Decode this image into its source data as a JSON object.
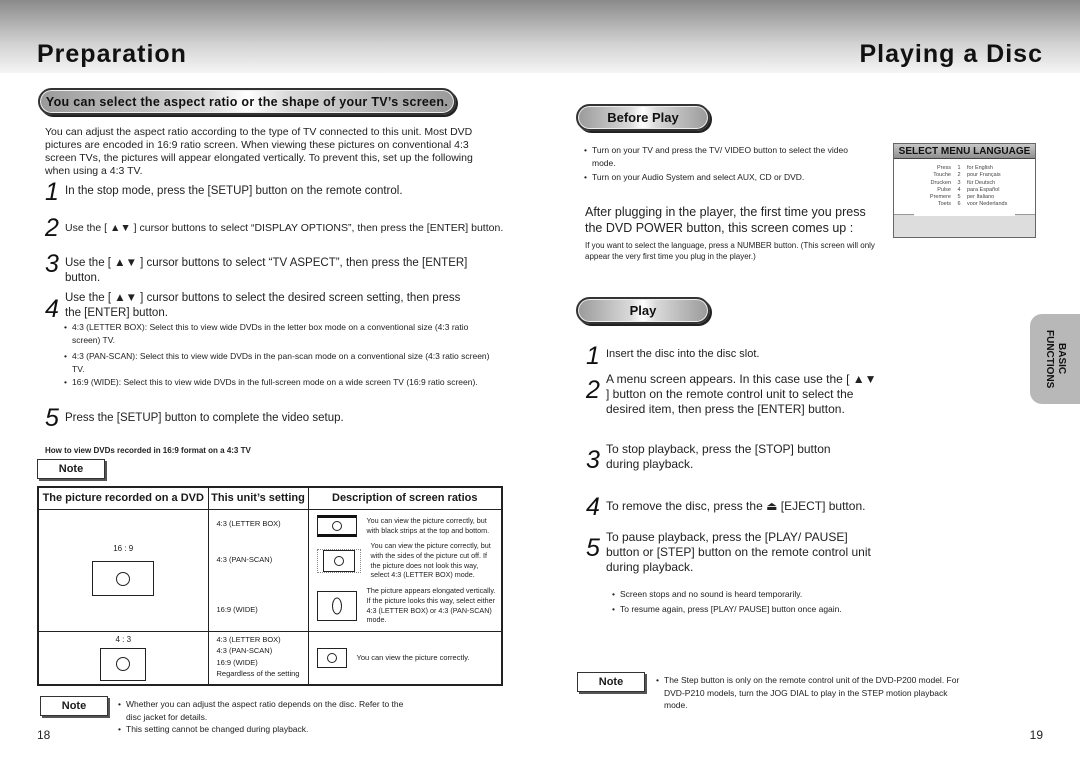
{
  "header": {
    "left_title": "Preparation",
    "right_title": "Playing a Disc"
  },
  "left": {
    "banner": "You can select the aspect ratio or the shape of your TV’s screen.",
    "intro": "You can adjust the aspect ratio according to the type of TV connected to this unit. Most DVD pictures are encoded in 16:9 ratio screen. When viewing these pictures on conventional 4:3 screen TVs, the pictures will appear elongated vertically. To prevent this, set up the following when using a 4:3 TV.",
    "steps": [
      {
        "num": "1",
        "text": "In the stop mode, press the [SETUP] button on the remote control."
      },
      {
        "num": "2",
        "text": "Use the [ ▲▼ ] cursor buttons to select “DISPLAY OPTIONS”, then press the [ENTER] button."
      },
      {
        "num": "3",
        "text": "Use the [ ▲▼ ] cursor buttons to select “TV ASPECT”, then press the [ENTER] button."
      },
      {
        "num": "4",
        "text": "Use the [ ▲▼ ] cursor buttons to select the desired screen setting, then press the [ENTER] button."
      },
      {
        "num": "5",
        "text": "Press the [SETUP] button to complete the video setup."
      }
    ],
    "step4_bullets": [
      "4:3 (LETTER BOX): Select this to view wide DVDs in the letter box mode on a conventional size (4:3 ratio screen) TV.",
      "4:3 (PAN-SCAN): Select this to view wide DVDs in the pan-scan mode on a conventional size (4:3 ratio screen) TV.",
      "16:9 (WIDE): Select this to view wide DVDs in the full-screen mode on a wide screen TV (16:9 ratio screen)."
    ],
    "howto_heading": "How to view DVDs recorded in 16:9 format on a 4:3 TV",
    "note_label": "Note",
    "table": {
      "headers": [
        "The picture recorded on a DVD",
        "This unit’s setting",
        "Description of screen ratios"
      ],
      "rows": [
        {
          "recorded": "16 : 9",
          "settings": [
            {
              "setting": "4:3 (LETTER BOX)",
              "description": "You can view the picture correctly, but with black strips at the top and bottom."
            },
            {
              "setting": "4:3 (PAN-SCAN)",
              "description": "You can view the picture correctly, but with the sides of the picture cut off. If the picture does not look this way, select 4:3 (LETTER BOX) mode."
            },
            {
              "setting": "16:9 (WIDE)",
              "description": "The picture appears elongated vertically. If the picture looks this way, select either 4:3 (LETTER BOX) or 4:3 (PAN-SCAN) mode."
            }
          ]
        },
        {
          "recorded": "4 : 3",
          "settings_list": [
            "4:3 (LETTER BOX)",
            "4:3 (PAN-SCAN)",
            "16:9 (WIDE)",
            "Regardless of the setting"
          ],
          "description": "You can view the picture correctly."
        }
      ]
    },
    "bottom_note": {
      "label": "Note",
      "bullets": [
        "Whether you can adjust the aspect ratio depends on the disc. Refer to the disc jacket for details.",
        "This setting cannot be changed during playback."
      ]
    },
    "page_number": "18"
  },
  "right": {
    "before_play": {
      "banner": "Before Play",
      "bullets": [
        "Turn on your TV and press the TV/ VIDEO button to select the video mode.",
        "Turn on your Audio System and select AUX, CD or DVD."
      ],
      "power_text": "After plugging in the player, the first time you press the DVD POWER button, this screen comes up :",
      "language_hint": "If you want to select the language, press a NUMBER button. (This screen will only appear the very first time you plug in the player.)"
    },
    "language_menu": {
      "title": "SELECT MENU LANGUAGE",
      "rows": [
        {
          "word": "Press",
          "num": "1",
          "lang": "for English"
        },
        {
          "word": "Touche",
          "num": "2",
          "lang": "pour Français"
        },
        {
          "word": "Drucken",
          "num": "3",
          "lang": "für Deutsch"
        },
        {
          "word": "Pulse",
          "num": "4",
          "lang": "para Español"
        },
        {
          "word": "Premere",
          "num": "5",
          "lang": "per Italiano"
        },
        {
          "word": "Toets",
          "num": "6",
          "lang": "voor Nederlands"
        }
      ]
    },
    "play": {
      "banner": "Play",
      "steps": [
        {
          "num": "1",
          "text": "Insert the disc into the disc slot."
        },
        {
          "num": "2",
          "text": "A menu screen appears.  In this case use the [ ▲▼ ] button on the remote control unit to select the desired item, then press the [ENTER] button."
        },
        {
          "num": "3",
          "text": "To stop playback, press the [STOP] button during playback."
        },
        {
          "num": "4",
          "text": "To remove the disc, press the ⏏ [EJECT] button."
        },
        {
          "num": "5",
          "text": "To pause playback, press the [PLAY/ PAUSE] button or [STEP] button on the remote control unit during playback."
        }
      ],
      "step5_bullets": [
        "Screen stops and no sound is heard temporarily.",
        "To resume again, press [PLAY/ PAUSE] button once again."
      ]
    },
    "note": {
      "label": "Note",
      "bullets": [
        "The Step button is only on the remote control unit of the DVD-P200 model. For DVD-P210 models, turn the JOG DIAL to play in the STEP motion playback mode."
      ]
    },
    "side_tab": "BASIC FUNCTIONS",
    "page_number": "19"
  }
}
